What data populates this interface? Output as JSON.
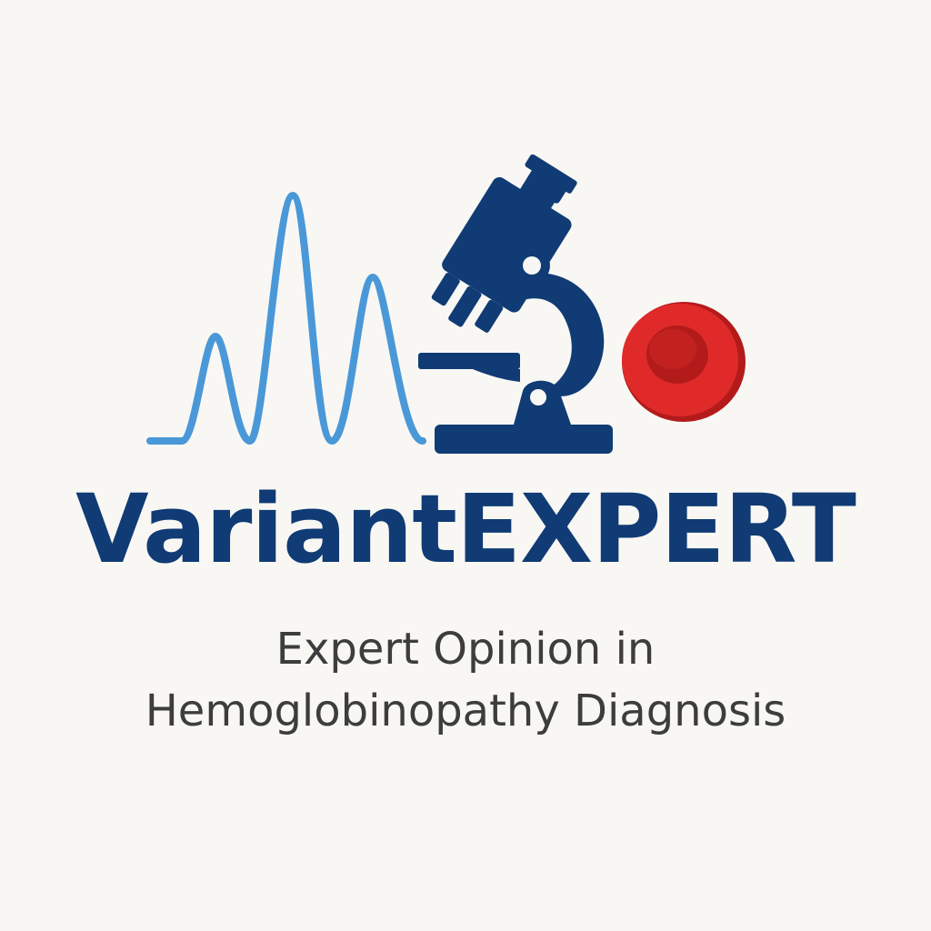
{
  "logo": {
    "brand_name": "VariantEXPERT",
    "tagline_line1": "Expert Opinion in",
    "tagline_line2": "Hemoglobinopathy Diagnosis",
    "icons": [
      "chromatogram-peaks-icon",
      "microscope-icon",
      "red-blood-cell-icon"
    ]
  },
  "colors": {
    "navy": "#103b74",
    "light_blue": "#4a98d8",
    "red": "#e02a2a",
    "dark_red": "#b31b1b",
    "text_gray": "#3d3d3d",
    "background": "#f8f7f4"
  }
}
